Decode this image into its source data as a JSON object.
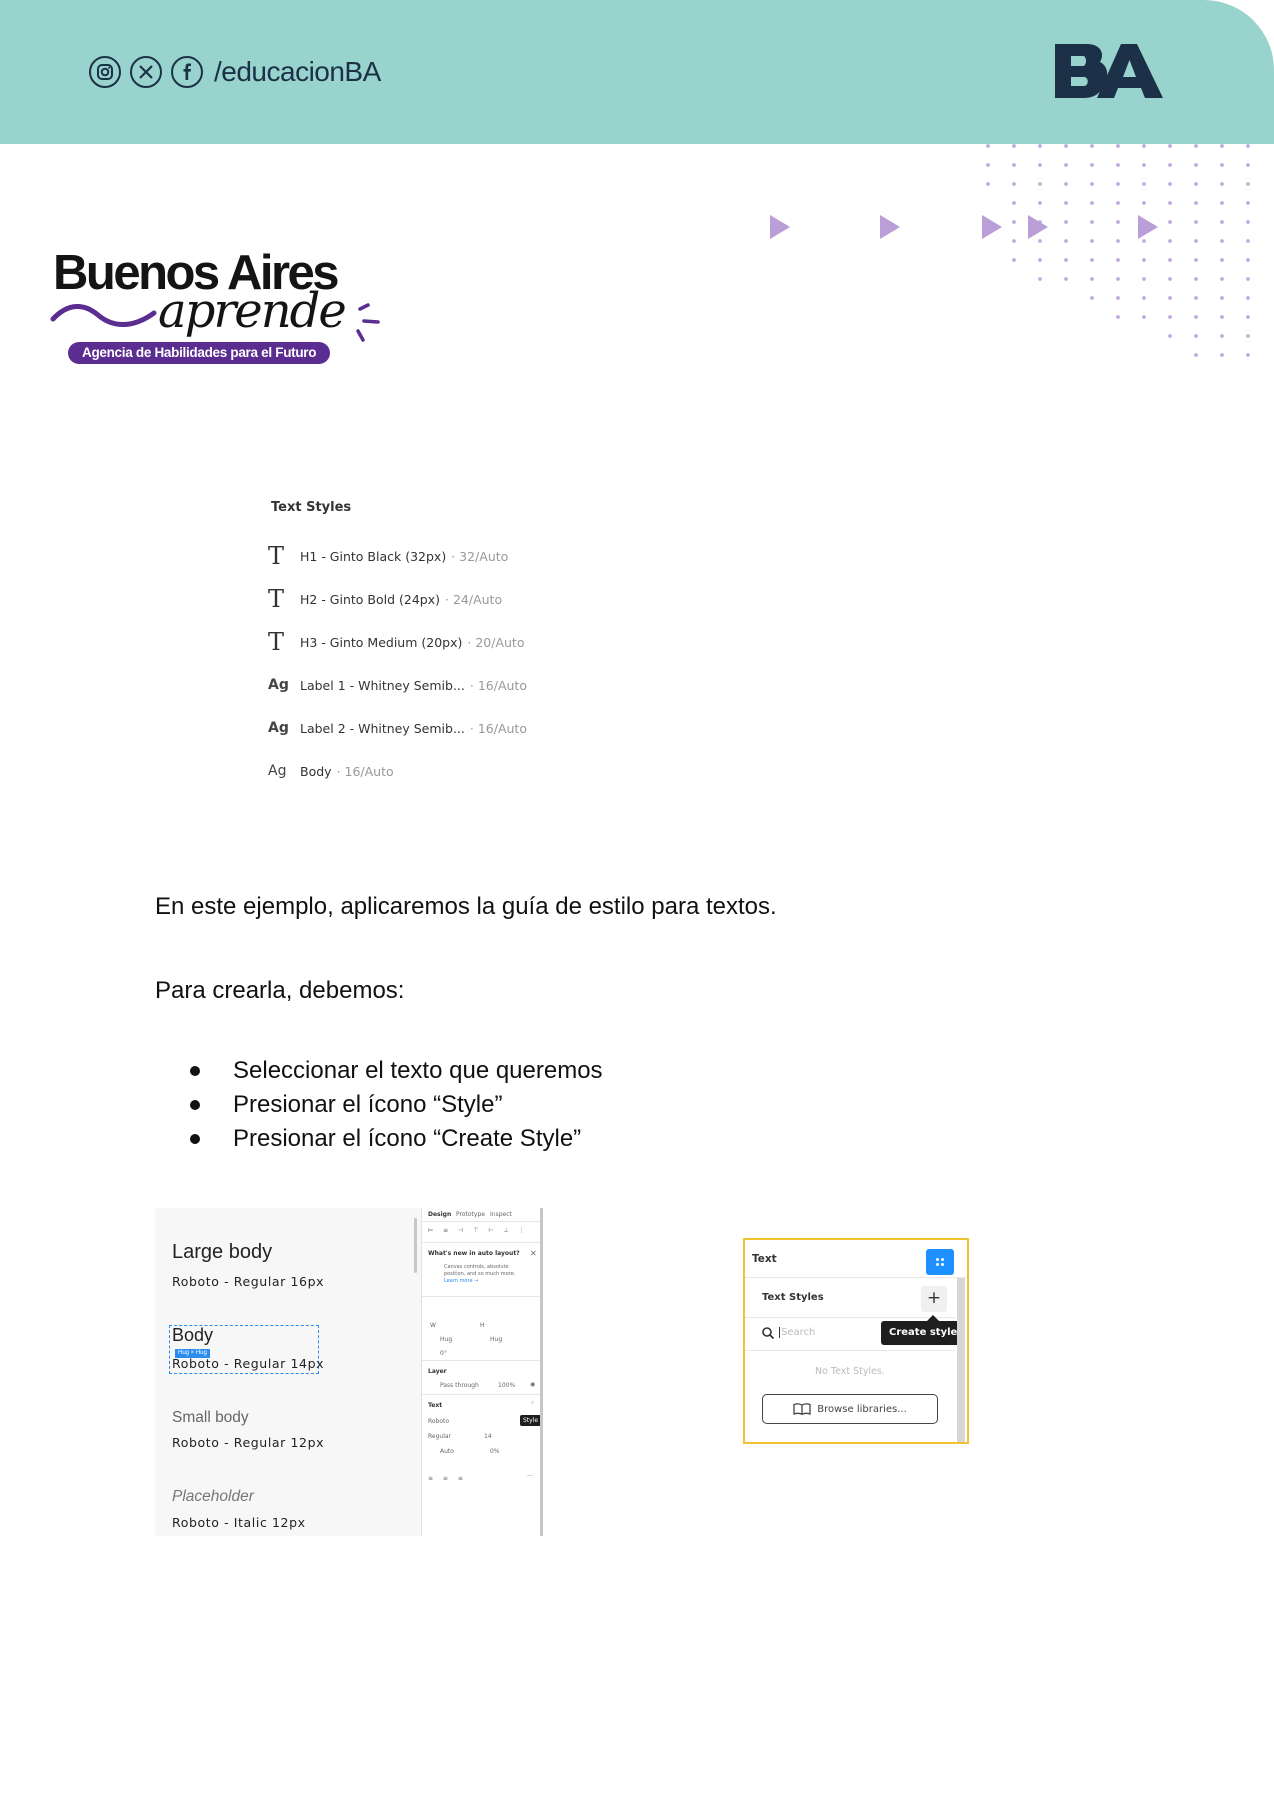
{
  "header": {
    "social_icons": [
      "instagram-icon",
      "x-icon",
      "facebook-icon"
    ],
    "handle": "/educacionBA",
    "logo_alt": "BA",
    "band_color": "#99d3cd"
  },
  "brand": {
    "title": "Buenos Aires",
    "script": "aprende",
    "tagline": "Agencia de Habilidades para el Futuro",
    "accent_color": "#5b2d91"
  },
  "text_styles_figure": {
    "heading": "Text Styles",
    "items": [
      {
        "icon": "T",
        "name": "H1 - Ginto Black (32px)",
        "meta": "· 32/Auto"
      },
      {
        "icon": "T",
        "name": "H2 - Ginto Bold (24px)",
        "meta": "· 24/Auto"
      },
      {
        "icon": "T",
        "name": "H3 - Ginto Medium (20px)",
        "meta": "· 20/Auto"
      },
      {
        "icon": "Ag",
        "name": "Label 1 - Whitney Semib...",
        "meta": "· 16/Auto"
      },
      {
        "icon": "Ag",
        "name": "Label 2 - Whitney Semib...",
        "meta": "· 16/Auto"
      },
      {
        "icon": "Ag",
        "name": "Body",
        "meta": "· 16/Auto"
      }
    ]
  },
  "content": {
    "intro": "En este ejemplo, aplicaremos la guía de estilo para textos.",
    "lead": "Para crearla, debemos:",
    "steps": [
      "Seleccionar el texto que queremos",
      "Presionar el ícono “Style”",
      "Presionar el ícono “Create Style”"
    ]
  },
  "figma_screenshot": {
    "styles": [
      {
        "label": "Large body",
        "spec": "Roboto - Regular 16px"
      },
      {
        "label": "Body",
        "spec": "Roboto - Regular 14px"
      },
      {
        "label": "Small body",
        "spec": "Roboto - Regular 12px"
      },
      {
        "label": "Placeholder",
        "spec": "Roboto - Italic 12px"
      }
    ],
    "hug_badge": "Hug × Hug",
    "panel": {
      "tabs": [
        "Design",
        "Prototype",
        "Inspect"
      ],
      "notice_title": "What's new in auto layout?",
      "notice_text_1": "Canvas controls, absolute",
      "notice_text_2": "position, and so much more.",
      "learn_more": "Learn more →",
      "layer_label": "Layer",
      "blend": "Pass through",
      "opacity": "100%",
      "text_label": "Text",
      "font": "Roboto",
      "weight": "Regular",
      "size": "14",
      "line_height": "Auto",
      "letter_spacing": "0%",
      "style_tooltip": "Style",
      "w_value": "Hug",
      "h_value": "Hug",
      "rotation": "0°"
    }
  },
  "text_panel_screenshot": {
    "title": "Text",
    "section": "Text Styles",
    "search_placeholder": "Search",
    "tooltip": "Create style",
    "empty": "No Text Styles.",
    "browse": "Browse libraries...",
    "highlight_color": "#f2c230",
    "button_color": "#1e90ff"
  }
}
